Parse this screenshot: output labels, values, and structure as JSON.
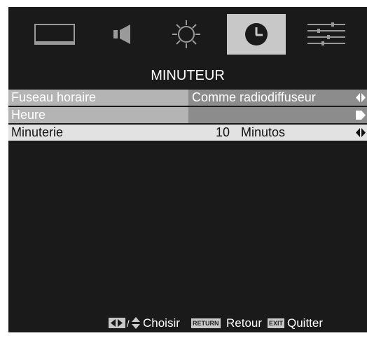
{
  "tabs": [
    {
      "icon": "picture-icon",
      "active": false
    },
    {
      "icon": "speaker-icon",
      "active": false
    },
    {
      "icon": "settings-sun-icon",
      "active": false
    },
    {
      "icon": "clock-icon",
      "active": true
    },
    {
      "icon": "sliders-icon",
      "active": false
    }
  ],
  "menu": {
    "title": "MINUTEUR",
    "rows": [
      {
        "label": "Fuseau horaire",
        "value": "Comme radiodiffuseur"
      },
      {
        "label": "Heure",
        "value": ""
      },
      {
        "label": "Minuterie",
        "value_num": "10",
        "value_unit": "Minutos"
      }
    ]
  },
  "footer": {
    "choose_label": "Choisir",
    "return_key": "RETURN",
    "return_label": "Retour",
    "exit_key": "EXIT",
    "exit_label": "Quitter"
  },
  "colors": {
    "background": "#1a1a1a",
    "active_tab": "#c8c8c8",
    "selected_row": "#e2e2e2",
    "dim_row_label": "#b4b4b4",
    "dim_row_value": "#8c8c8c"
  }
}
